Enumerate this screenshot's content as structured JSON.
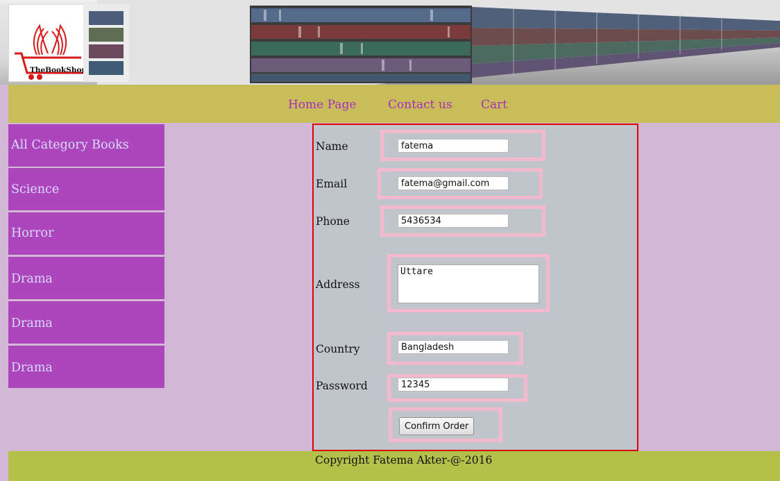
{
  "brand": {
    "logo_text": "TheBookShop"
  },
  "nav": {
    "items": [
      "Home Page",
      "Contact us",
      "Cart"
    ]
  },
  "sidebar": {
    "items": [
      "All Category Books",
      "Science",
      "Horror",
      "Drama",
      "Drama",
      "Drama"
    ]
  },
  "form": {
    "fields": {
      "name": {
        "label": "Name",
        "value": "fatema"
      },
      "email": {
        "label": "Email",
        "value": "fatema@gmail.com"
      },
      "phone": {
        "label": "Phone",
        "value": "5436534"
      },
      "address": {
        "label": "Address",
        "value": "Uttare"
      },
      "country": {
        "label": "Country",
        "value": "Bangladesh"
      },
      "password": {
        "label": "Password",
        "value": "12345"
      }
    },
    "submit_label": "Confirm Order"
  },
  "footer": {
    "text": "Copyright Fatema Akter-@-2016"
  },
  "colors": {
    "nav_bg": "#c8bd59",
    "nav_link": "#a52ec0",
    "sidebar_bg": "#ad45bd",
    "sidebar_text": "#d7dcff",
    "page_bg": "#d1b9d6",
    "form_bg": "#bfc5ca",
    "form_border": "#e00000",
    "highlight": "#f5b9cf",
    "footer_bg": "#b3c04a"
  }
}
